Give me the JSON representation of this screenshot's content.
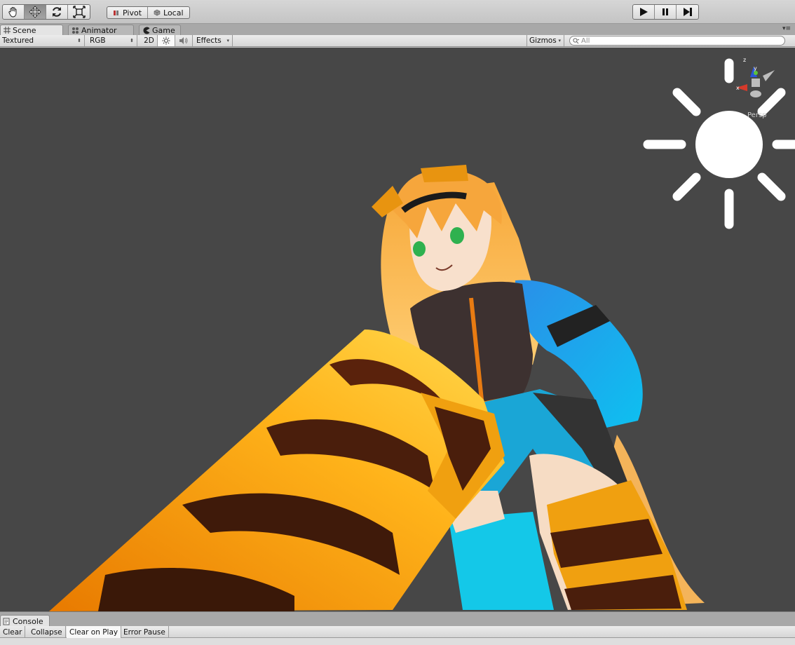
{
  "toolbar": {
    "tools": [
      {
        "name": "hand-tool",
        "icon": "hand-icon",
        "active": false
      },
      {
        "name": "move-tool",
        "icon": "move-icon",
        "active": true
      },
      {
        "name": "rotate-tool",
        "icon": "rotate-icon",
        "active": false
      },
      {
        "name": "scale-tool",
        "icon": "scale-icon",
        "active": false
      }
    ],
    "pivot_label": "Pivot",
    "local_label": "Local",
    "playback": [
      "play-icon",
      "pause-icon",
      "step-icon"
    ]
  },
  "tabs": [
    {
      "label": "Scene",
      "icon": "grid-icon",
      "active": true
    },
    {
      "label": "Animator",
      "icon": "animator-icon",
      "active": false
    },
    {
      "label": "Game",
      "icon": "pacman-icon",
      "active": false
    }
  ],
  "scene_toolbar": {
    "draw_mode": "Textured",
    "render_mode": "RGB",
    "mode_2d": "2D",
    "effects": "Effects",
    "gizmos": "Gizmos",
    "search_placeholder": "All"
  },
  "viewport": {
    "background": "#474747",
    "gizmo_axes": {
      "z": "z",
      "y": "y",
      "x": "x"
    },
    "projection": "Persp"
  },
  "console": {
    "tab_label": "Console",
    "buttons": [
      "Clear",
      "Collapse",
      "Clear on Play",
      "Error Pause"
    ]
  },
  "colors": {
    "hair": "#f0b050",
    "skin": "#f6dcc4",
    "cloth_blue": "#1aa6d6",
    "cloth_dark": "#3a2e2b",
    "stripe_orange": "#f0a010",
    "stripe_brown": "#4a1e0c"
  }
}
